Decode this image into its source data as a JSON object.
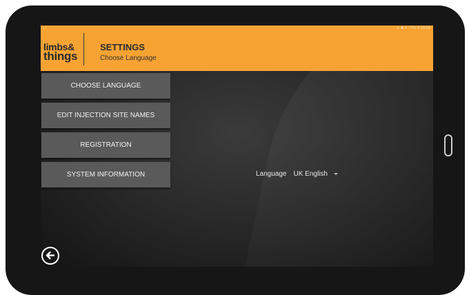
{
  "status": {
    "left_icons": "▪ ◌",
    "right_text": "⚹ ◀ ▯ 77% ▮ 10:54"
  },
  "header": {
    "logo_line1": "limbs&",
    "logo_line2": "things",
    "title": "SETTINGS",
    "subtitle": "Choose Language",
    "color": "#f7a334"
  },
  "menu": {
    "items": [
      {
        "label": "CHOOSE LANGUAGE"
      },
      {
        "label": "EDIT INJECTION SITE NAMES"
      },
      {
        "label": "REGISTRATION"
      },
      {
        "label": "SYSTEM INFORMATION"
      }
    ]
  },
  "language": {
    "label": "Language",
    "selected": "UK English"
  },
  "nav": {
    "back_icon": "back-arrow-icon"
  }
}
